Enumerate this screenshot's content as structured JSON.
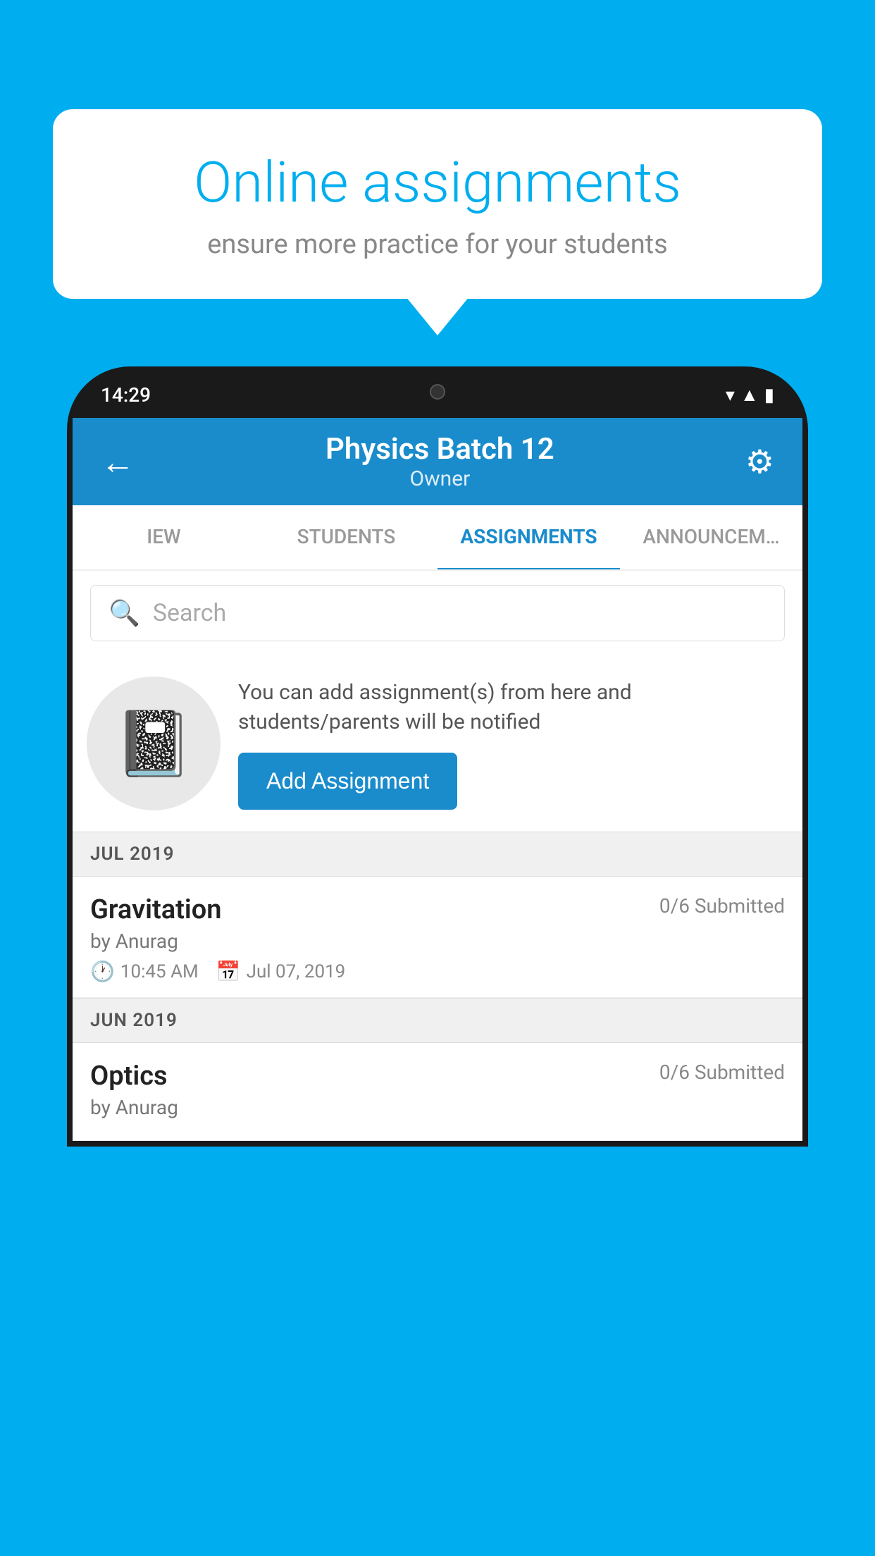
{
  "background_color": "#00AEEF",
  "speech_bubble": {
    "title": "Online assignments",
    "subtitle": "ensure more practice for your students"
  },
  "status_bar": {
    "time": "14:29",
    "icons": [
      "wifi",
      "signal",
      "battery"
    ]
  },
  "app_header": {
    "title": "Physics Batch 12",
    "subtitle": "Owner",
    "back_label": "←",
    "settings_label": "⚙"
  },
  "tabs": [
    {
      "label": "IEW",
      "active": false
    },
    {
      "label": "STUDENTS",
      "active": false
    },
    {
      "label": "ASSIGNMENTS",
      "active": true
    },
    {
      "label": "ANNOUNCEM…",
      "active": false
    }
  ],
  "search": {
    "placeholder": "Search"
  },
  "promo": {
    "description": "You can add assignment(s) from here and students/parents will be notified",
    "button_label": "Add Assignment"
  },
  "sections": [
    {
      "label": "JUL 2019",
      "assignments": [
        {
          "name": "Gravitation",
          "submitted": "0/6 Submitted",
          "author": "by Anurag",
          "time": "10:45 AM",
          "date": "Jul 07, 2019"
        }
      ]
    },
    {
      "label": "JUN 2019",
      "assignments": [
        {
          "name": "Optics",
          "submitted": "0/6 Submitted",
          "author": "by Anurag",
          "time": "",
          "date": ""
        }
      ]
    }
  ]
}
